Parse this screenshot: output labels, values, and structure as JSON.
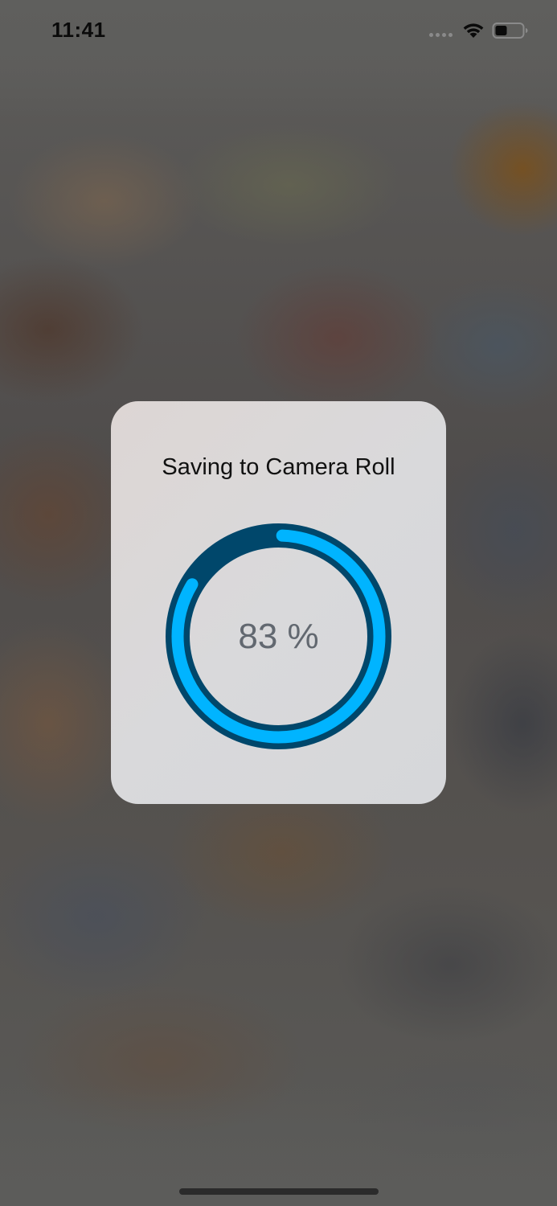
{
  "status_bar": {
    "time": "11:41",
    "icons": [
      "signal-dots-icon",
      "wifi-icon",
      "battery-icon"
    ]
  },
  "dialog": {
    "title": "Saving to Camera Roll",
    "progress": {
      "value": 83,
      "label": "83 %"
    }
  },
  "colors": {
    "ring_track": "#00476b",
    "ring_fill": "#00b4ff",
    "dialog_bg": "#d9d9db",
    "progress_text": "#626870"
  }
}
